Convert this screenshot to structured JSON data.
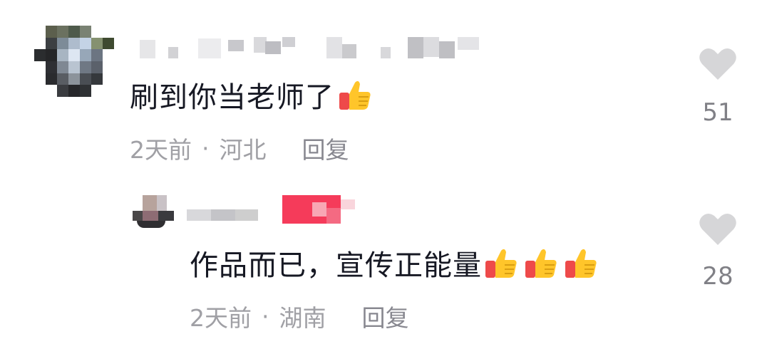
{
  "comments": [
    {
      "text": "刷到你当老师了",
      "emoji_count": 1,
      "time": "2天前",
      "location": "河北",
      "reply_label": "回复",
      "likes": "51"
    },
    {
      "text": "作品而已，宣传正能量",
      "emoji_count": 3,
      "time": "2天前",
      "location": "湖南",
      "reply_label": "回复",
      "likes": "28"
    }
  ],
  "separator": "·",
  "icons": {
    "like": "heart-icon",
    "emoji": "thumbs-up-icon"
  },
  "colors": {
    "text": "#161823",
    "meta": "#a0a0a5",
    "heart": "#d6d6d8",
    "author_badge": "#f53b5a"
  }
}
